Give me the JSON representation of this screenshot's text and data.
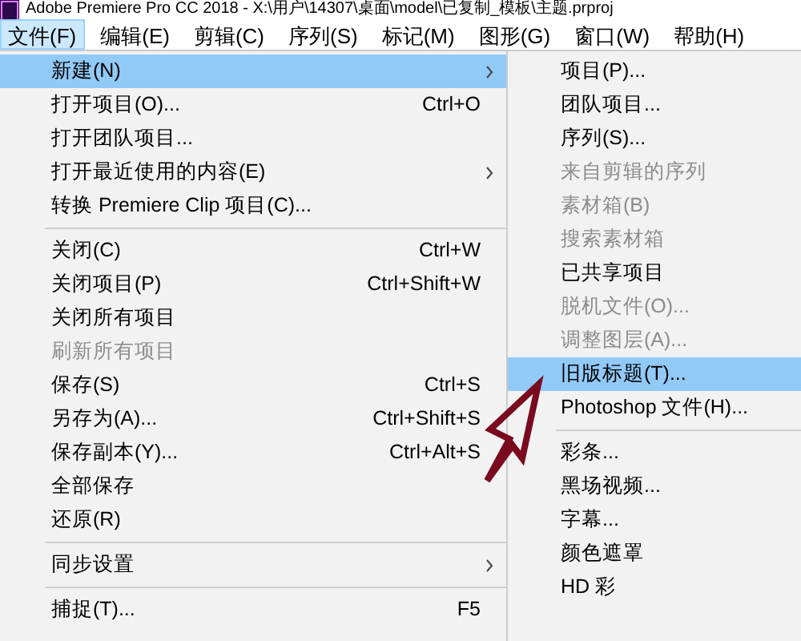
{
  "window": {
    "title": "Adobe Premiere Pro CC 2018 - X:\\用户\\14307\\桌面\\model\\已复制_模板\\主题.prproj"
  },
  "menubar": [
    {
      "label": "文件(F)",
      "selected": true
    },
    {
      "label": "编辑(E)",
      "selected": false
    },
    {
      "label": "剪辑(C)",
      "selected": false
    },
    {
      "label": "序列(S)",
      "selected": false
    },
    {
      "label": "标记(M)",
      "selected": false
    },
    {
      "label": "图形(G)",
      "selected": false
    },
    {
      "label": "窗口(W)",
      "selected": false
    },
    {
      "label": "帮助(H)",
      "selected": false
    }
  ],
  "file_menu": [
    {
      "kind": "item",
      "label": "新建(N)",
      "selected": true,
      "disabled": false,
      "submenu": true
    },
    {
      "kind": "item",
      "label": "打开项目(O)...",
      "shortcut": "Ctrl+O",
      "selected": false,
      "disabled": false,
      "submenu": false
    },
    {
      "kind": "item",
      "label": "打开团队项目...",
      "selected": false,
      "disabled": false,
      "submenu": false
    },
    {
      "kind": "item",
      "label": "打开最近使用的内容(E)",
      "selected": false,
      "disabled": false,
      "submenu": true
    },
    {
      "kind": "item",
      "label": "转换 Premiere Clip 项目(C)...",
      "selected": false,
      "disabled": false,
      "submenu": false
    },
    {
      "kind": "separator"
    },
    {
      "kind": "item",
      "label": "关闭(C)",
      "shortcut": "Ctrl+W",
      "selected": false,
      "disabled": false,
      "submenu": false
    },
    {
      "kind": "item",
      "label": "关闭项目(P)",
      "shortcut": "Ctrl+Shift+W",
      "selected": false,
      "disabled": false,
      "submenu": false
    },
    {
      "kind": "item",
      "label": "关闭所有项目",
      "selected": false,
      "disabled": false,
      "submenu": false
    },
    {
      "kind": "item",
      "label": "刷新所有项目",
      "selected": false,
      "disabled": true,
      "submenu": false
    },
    {
      "kind": "item",
      "label": "保存(S)",
      "shortcut": "Ctrl+S",
      "selected": false,
      "disabled": false,
      "submenu": false
    },
    {
      "kind": "item",
      "label": "另存为(A)...",
      "shortcut": "Ctrl+Shift+S",
      "selected": false,
      "disabled": false,
      "submenu": false
    },
    {
      "kind": "item",
      "label": "保存副本(Y)...",
      "shortcut": "Ctrl+Alt+S",
      "selected": false,
      "disabled": false,
      "submenu": false
    },
    {
      "kind": "item",
      "label": "全部保存",
      "selected": false,
      "disabled": false,
      "submenu": false
    },
    {
      "kind": "item",
      "label": "还原(R)",
      "selected": false,
      "disabled": false,
      "submenu": false
    },
    {
      "kind": "separator"
    },
    {
      "kind": "item",
      "label": "同步设置",
      "selected": false,
      "disabled": false,
      "submenu": true
    },
    {
      "kind": "separator"
    },
    {
      "kind": "item",
      "label": "捕捉(T)...",
      "shortcut": "F5",
      "selected": false,
      "disabled": false,
      "submenu": false
    }
  ],
  "new_submenu": [
    {
      "kind": "item",
      "label": "项目(P)...",
      "selected": false,
      "disabled": false
    },
    {
      "kind": "item",
      "label": "团队项目...",
      "selected": false,
      "disabled": false
    },
    {
      "kind": "item",
      "label": "序列(S)...",
      "selected": false,
      "disabled": false
    },
    {
      "kind": "item",
      "label": "来自剪辑的序列",
      "selected": false,
      "disabled": true
    },
    {
      "kind": "item",
      "label": "素材箱(B)",
      "selected": false,
      "disabled": true
    },
    {
      "kind": "item",
      "label": "搜索素材箱",
      "selected": false,
      "disabled": true
    },
    {
      "kind": "item",
      "label": "已共享项目",
      "selected": false,
      "disabled": false
    },
    {
      "kind": "item",
      "label": "脱机文件(O)...",
      "selected": false,
      "disabled": true
    },
    {
      "kind": "item",
      "label": "调整图层(A)...",
      "selected": false,
      "disabled": true
    },
    {
      "kind": "item",
      "label": "旧版标题(T)...",
      "selected": true,
      "disabled": false
    },
    {
      "kind": "item",
      "label": "Photoshop 文件(H)...",
      "selected": false,
      "disabled": false
    },
    {
      "kind": "separator"
    },
    {
      "kind": "item",
      "label": "彩条...",
      "selected": false,
      "disabled": false
    },
    {
      "kind": "item",
      "label": "黑场视频...",
      "selected": false,
      "disabled": false
    },
    {
      "kind": "item",
      "label": "字幕...",
      "selected": false,
      "disabled": false
    },
    {
      "kind": "item",
      "label": "颜色遮罩",
      "selected": false,
      "disabled": false
    },
    {
      "kind": "item",
      "label": "HD 彩",
      "selected": false,
      "disabled": false
    }
  ]
}
